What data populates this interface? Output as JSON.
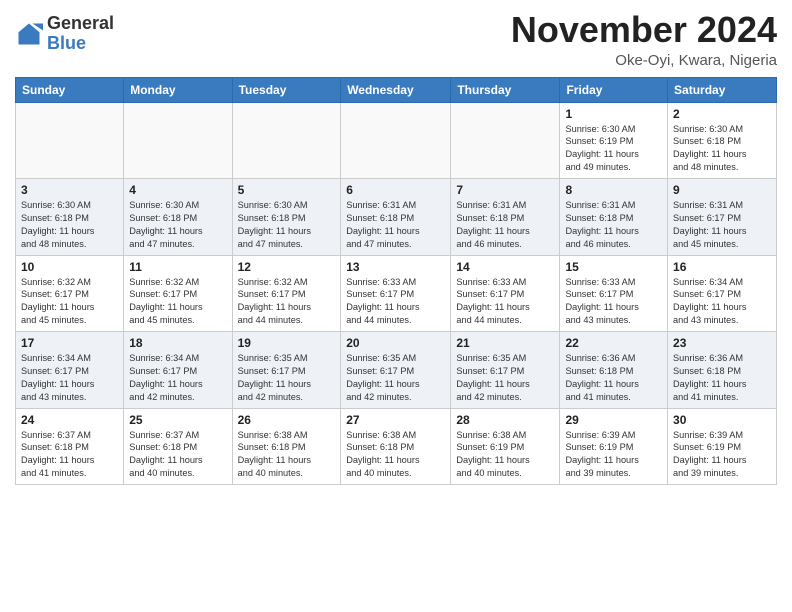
{
  "header": {
    "logo_line1": "General",
    "logo_line2": "Blue",
    "month_title": "November 2024",
    "location": "Oke-Oyi, Kwara, Nigeria"
  },
  "weekdays": [
    "Sunday",
    "Monday",
    "Tuesday",
    "Wednesday",
    "Thursday",
    "Friday",
    "Saturday"
  ],
  "weeks": [
    [
      {
        "day": "",
        "info": ""
      },
      {
        "day": "",
        "info": ""
      },
      {
        "day": "",
        "info": ""
      },
      {
        "day": "",
        "info": ""
      },
      {
        "day": "",
        "info": ""
      },
      {
        "day": "1",
        "info": "Sunrise: 6:30 AM\nSunset: 6:19 PM\nDaylight: 11 hours\nand 49 minutes."
      },
      {
        "day": "2",
        "info": "Sunrise: 6:30 AM\nSunset: 6:18 PM\nDaylight: 11 hours\nand 48 minutes."
      }
    ],
    [
      {
        "day": "3",
        "info": "Sunrise: 6:30 AM\nSunset: 6:18 PM\nDaylight: 11 hours\nand 48 minutes."
      },
      {
        "day": "4",
        "info": "Sunrise: 6:30 AM\nSunset: 6:18 PM\nDaylight: 11 hours\nand 47 minutes."
      },
      {
        "day": "5",
        "info": "Sunrise: 6:30 AM\nSunset: 6:18 PM\nDaylight: 11 hours\nand 47 minutes."
      },
      {
        "day": "6",
        "info": "Sunrise: 6:31 AM\nSunset: 6:18 PM\nDaylight: 11 hours\nand 47 minutes."
      },
      {
        "day": "7",
        "info": "Sunrise: 6:31 AM\nSunset: 6:18 PM\nDaylight: 11 hours\nand 46 minutes."
      },
      {
        "day": "8",
        "info": "Sunrise: 6:31 AM\nSunset: 6:18 PM\nDaylight: 11 hours\nand 46 minutes."
      },
      {
        "day": "9",
        "info": "Sunrise: 6:31 AM\nSunset: 6:17 PM\nDaylight: 11 hours\nand 45 minutes."
      }
    ],
    [
      {
        "day": "10",
        "info": "Sunrise: 6:32 AM\nSunset: 6:17 PM\nDaylight: 11 hours\nand 45 minutes."
      },
      {
        "day": "11",
        "info": "Sunrise: 6:32 AM\nSunset: 6:17 PM\nDaylight: 11 hours\nand 45 minutes."
      },
      {
        "day": "12",
        "info": "Sunrise: 6:32 AM\nSunset: 6:17 PM\nDaylight: 11 hours\nand 44 minutes."
      },
      {
        "day": "13",
        "info": "Sunrise: 6:33 AM\nSunset: 6:17 PM\nDaylight: 11 hours\nand 44 minutes."
      },
      {
        "day": "14",
        "info": "Sunrise: 6:33 AM\nSunset: 6:17 PM\nDaylight: 11 hours\nand 44 minutes."
      },
      {
        "day": "15",
        "info": "Sunrise: 6:33 AM\nSunset: 6:17 PM\nDaylight: 11 hours\nand 43 minutes."
      },
      {
        "day": "16",
        "info": "Sunrise: 6:34 AM\nSunset: 6:17 PM\nDaylight: 11 hours\nand 43 minutes."
      }
    ],
    [
      {
        "day": "17",
        "info": "Sunrise: 6:34 AM\nSunset: 6:17 PM\nDaylight: 11 hours\nand 43 minutes."
      },
      {
        "day": "18",
        "info": "Sunrise: 6:34 AM\nSunset: 6:17 PM\nDaylight: 11 hours\nand 42 minutes."
      },
      {
        "day": "19",
        "info": "Sunrise: 6:35 AM\nSunset: 6:17 PM\nDaylight: 11 hours\nand 42 minutes."
      },
      {
        "day": "20",
        "info": "Sunrise: 6:35 AM\nSunset: 6:17 PM\nDaylight: 11 hours\nand 42 minutes."
      },
      {
        "day": "21",
        "info": "Sunrise: 6:35 AM\nSunset: 6:17 PM\nDaylight: 11 hours\nand 42 minutes."
      },
      {
        "day": "22",
        "info": "Sunrise: 6:36 AM\nSunset: 6:18 PM\nDaylight: 11 hours\nand 41 minutes."
      },
      {
        "day": "23",
        "info": "Sunrise: 6:36 AM\nSunset: 6:18 PM\nDaylight: 11 hours\nand 41 minutes."
      }
    ],
    [
      {
        "day": "24",
        "info": "Sunrise: 6:37 AM\nSunset: 6:18 PM\nDaylight: 11 hours\nand 41 minutes."
      },
      {
        "day": "25",
        "info": "Sunrise: 6:37 AM\nSunset: 6:18 PM\nDaylight: 11 hours\nand 40 minutes."
      },
      {
        "day": "26",
        "info": "Sunrise: 6:38 AM\nSunset: 6:18 PM\nDaylight: 11 hours\nand 40 minutes."
      },
      {
        "day": "27",
        "info": "Sunrise: 6:38 AM\nSunset: 6:18 PM\nDaylight: 11 hours\nand 40 minutes."
      },
      {
        "day": "28",
        "info": "Sunrise: 6:38 AM\nSunset: 6:19 PM\nDaylight: 11 hours\nand 40 minutes."
      },
      {
        "day": "29",
        "info": "Sunrise: 6:39 AM\nSunset: 6:19 PM\nDaylight: 11 hours\nand 39 minutes."
      },
      {
        "day": "30",
        "info": "Sunrise: 6:39 AM\nSunset: 6:19 PM\nDaylight: 11 hours\nand 39 minutes."
      }
    ]
  ]
}
